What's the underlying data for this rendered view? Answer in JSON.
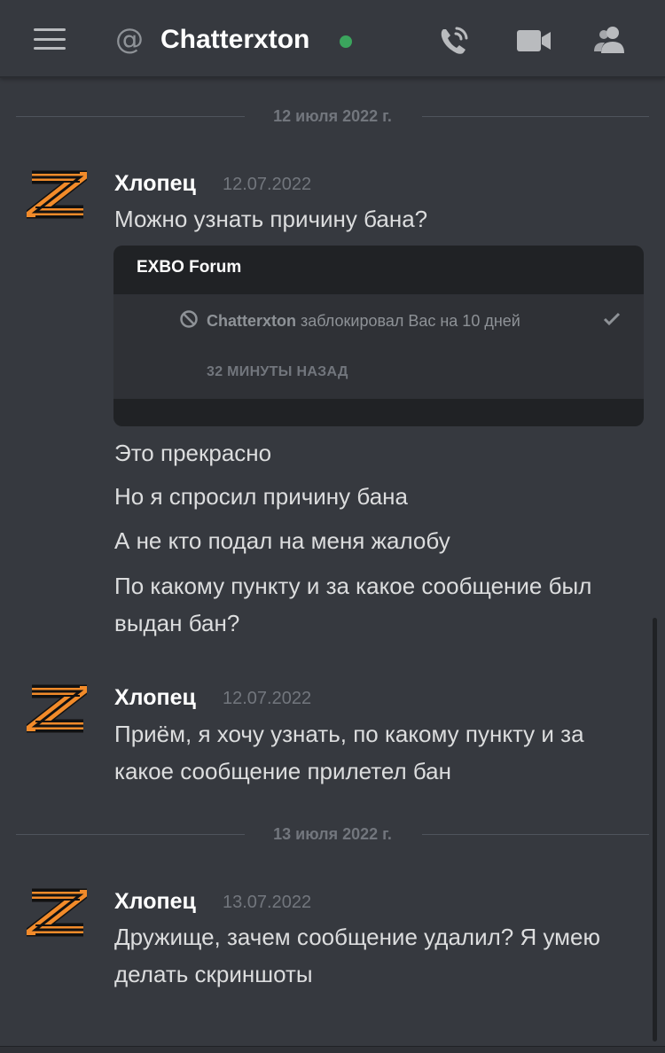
{
  "header": {
    "channel_name": "Chatterxton",
    "status": "online",
    "status_color": "#3ba55d",
    "icons": [
      "menu-icon",
      "at-icon",
      "call-icon",
      "video-icon",
      "members-icon"
    ]
  },
  "date_dividers": [
    {
      "label": "12 июля 2022 г."
    },
    {
      "label": "13 июля 2022 г."
    }
  ],
  "messages": [
    {
      "author": "Хлопец",
      "timestamp": "12.07.2022",
      "lines": [
        "Можно узнать причину бана?"
      ],
      "embed": {
        "title": "EXBO Forum",
        "notification_user": "Chatterxton",
        "notification_text": "заблокировал Вас на 10 дней",
        "time": "32 МИНУТЫ НАЗАД"
      },
      "followups": [
        "Это прекрасно",
        "Но я спросил причину бана",
        "А не кто подал на меня жалобу",
        "По какому пункту и за какое сообщение был выдан бан?"
      ]
    },
    {
      "author": "Хлопец",
      "timestamp": "12.07.2022",
      "lines": [
        "Приём, я хочу узнать, по какому пункту и за какое сообщение прилетел бан"
      ]
    },
    {
      "author": "Хлопец",
      "timestamp": "13.07.2022",
      "lines": [
        "Дружище, зачем сообщение удалил? Я умею делать скриншоты"
      ]
    }
  ]
}
